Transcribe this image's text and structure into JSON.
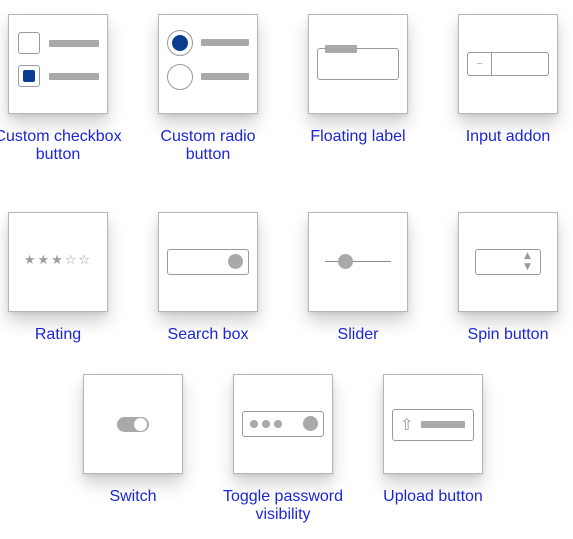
{
  "cards": [
    {
      "id": "custom-checkbox-button",
      "label": "Custom checkbox button"
    },
    {
      "id": "custom-radio-button",
      "label": "Custom radio button"
    },
    {
      "id": "floating-label",
      "label": "Floating label"
    },
    {
      "id": "input-addon",
      "label": "Input addon"
    },
    {
      "id": "rating",
      "label": "Rating"
    },
    {
      "id": "search-box",
      "label": "Search box"
    },
    {
      "id": "slider",
      "label": "Slider"
    },
    {
      "id": "spin-button",
      "label": "Spin button"
    },
    {
      "id": "switch",
      "label": "Switch"
    },
    {
      "id": "toggle-password-visibility",
      "label": "Toggle password visibility"
    },
    {
      "id": "upload-button",
      "label": "Upload button"
    }
  ],
  "illustrations": {
    "input_addon_symbol": "–",
    "rating_stars": [
      "★",
      "★",
      "★",
      "☆",
      "☆"
    ],
    "rating_value": 3,
    "rating_max": 5,
    "spin_up": "▲",
    "spin_down": "▼",
    "upload_icon": "⇧",
    "password_dots": [
      "●",
      "●",
      "●"
    ]
  },
  "colors": {
    "link": "#1c27d8",
    "accent": "#0d3d91",
    "gray": "#a9a9a9",
    "border": "#b6b6b6"
  }
}
